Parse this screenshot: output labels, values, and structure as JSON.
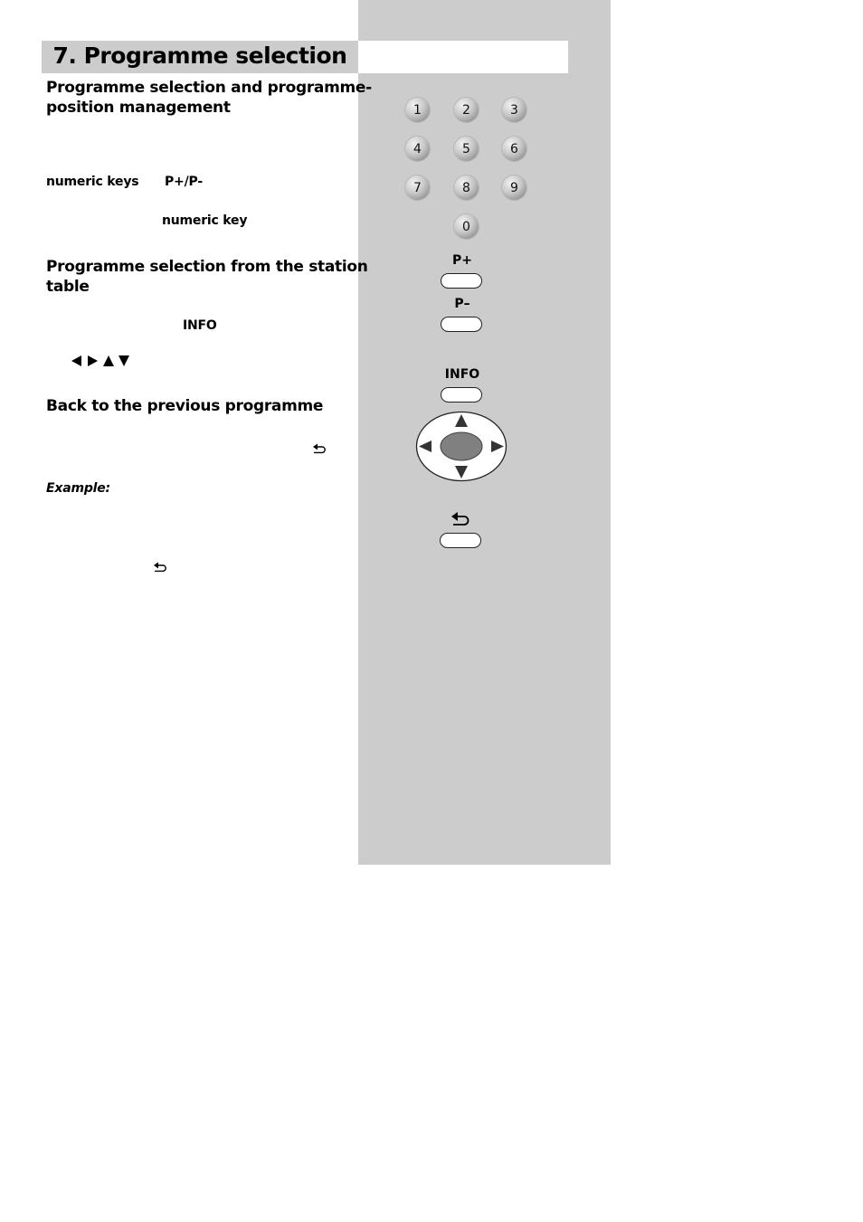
{
  "title": "7. Programme selection",
  "sections": [
    {
      "heading_line1": "Programme selection and programme-",
      "heading_line2": "position management",
      "keywords": {
        "numeric_keys": "numeric keys",
        "p_plus_minus": "P+/P-",
        "numeric_key": "numeric key"
      }
    },
    {
      "heading_line1": "Programme selection from the station",
      "heading_line2": "table",
      "keywords": {
        "info": "INFO",
        "arrows": "◀ ▶ ▲ ▼"
      }
    },
    {
      "heading": "Back to the previous programme",
      "return_symbol": "↩",
      "example_label": "Example:",
      "return_symbol_example": "↩"
    }
  ],
  "remote": {
    "numeric_keys": [
      "1",
      "2",
      "3",
      "4",
      "5",
      "6",
      "7",
      "8",
      "9",
      "0"
    ],
    "p_plus_label": "P+",
    "p_minus_label": "P–",
    "info_label": "INFO",
    "icons": {
      "dpad": "dpad-icon",
      "return": "return-icon"
    }
  },
  "colors": {
    "panel_gray": "#cccccc",
    "dpad_center": "#808080",
    "arrow": "#333333"
  }
}
